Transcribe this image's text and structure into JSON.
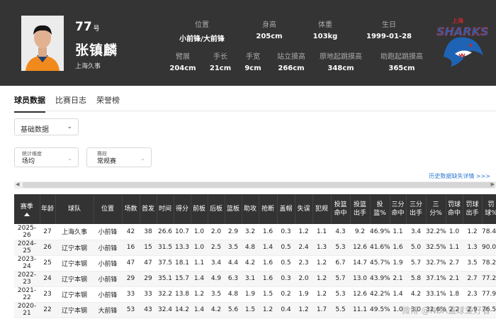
{
  "player": {
    "number": "77",
    "number_suffix": "号",
    "name": "张镇麟",
    "team": "上海久事"
  },
  "attrs_top": [
    {
      "label": "位置",
      "value": "小前锋/大前锋"
    },
    {
      "label": "身高",
      "value": "205cm"
    },
    {
      "label": "体重",
      "value": "103kg"
    },
    {
      "label": "生日",
      "value": "1999-01-28"
    }
  ],
  "attrs_bottom": [
    {
      "label": "臂展",
      "value": "204cm"
    },
    {
      "label": "手长",
      "value": "21cm"
    },
    {
      "label": "手宽",
      "value": "9cm"
    },
    {
      "label": "站立摸高",
      "value": "266cm"
    },
    {
      "label": "原地起跳摸高",
      "value": "348cm"
    },
    {
      "label": "助跑起跳摸高",
      "value": "365cm"
    }
  ],
  "logo": {
    "text": "SHARKS",
    "top_text": "上海",
    "primary": "#1f63b5",
    "accent": "#c7282d"
  },
  "tabs": [
    "球员数据",
    "比赛日志",
    "荣誉榜"
  ],
  "filters": {
    "data_type": "基础数据",
    "dimension_label": "统计维度",
    "dimension_value": "场均",
    "stage_label": "赛段",
    "stage_value": "常规赛"
  },
  "history_link": "历史数据缺失详情 >>>",
  "table": {
    "headers": [
      "赛季",
      "年龄",
      "球队",
      "位置",
      "场数",
      "首发",
      "时间",
      "得分",
      "前板",
      "后板",
      "篮板",
      "助攻",
      "抢断",
      "盖帽",
      "失误",
      "犯规",
      "投篮命中",
      "投篮出手",
      "投篮%",
      "三分命中",
      "三分出手",
      "三分%",
      "罚球命中",
      "罚球出手",
      "罚球%"
    ],
    "rows": [
      [
        "2025-26",
        "27",
        "上海久事",
        "小前锋",
        "42",
        "38",
        "26.6",
        "10.7",
        "1.0",
        "2.0",
        "2.9",
        "3.2",
        "1.6",
        "0.3",
        "1.2",
        "1.1",
        "4.3",
        "9.2",
        "46.9%",
        "1.1",
        "3.4",
        "32.2%",
        "1.0",
        "1.2",
        "78.4%"
      ],
      [
        "2024-25",
        "26",
        "辽宁本钢",
        "小前锋",
        "16",
        "15",
        "31.5",
        "13.3",
        "1.0",
        "2.5",
        "3.5",
        "4.8",
        "1.4",
        "0.5",
        "2.4",
        "1.3",
        "5.3",
        "12.6",
        "41.6%",
        "1.6",
        "5.0",
        "32.5%",
        "1.1",
        "1.3",
        "90.0%"
      ],
      [
        "2023-24",
        "25",
        "辽宁本钢",
        "小前锋",
        "47",
        "47",
        "37.5",
        "18.1",
        "1.1",
        "3.4",
        "4.4",
        "4.2",
        "1.6",
        "0.5",
        "2.3",
        "1.2",
        "6.7",
        "14.7",
        "45.7%",
        "1.9",
        "5.7",
        "32.7%",
        "2.7",
        "3.5",
        "78.2%"
      ],
      [
        "2022-23",
        "24",
        "辽宁本钢",
        "小前锋",
        "29",
        "29",
        "35.1",
        "15.7",
        "1.4",
        "4.9",
        "6.3",
        "3.1",
        "1.6",
        "0.3",
        "2.0",
        "1.2",
        "5.7",
        "13.0",
        "43.9%",
        "2.1",
        "5.8",
        "37.1%",
        "2.1",
        "2.7",
        "77.2%"
      ],
      [
        "2021-22",
        "23",
        "辽宁本钢",
        "小前锋",
        "33",
        "33",
        "32.2",
        "13.8",
        "1.2",
        "3.5",
        "4.8",
        "1.9",
        "1.5",
        "0.2",
        "1.9",
        "1.2",
        "5.3",
        "12.6",
        "42.2%",
        "1.4",
        "4.2",
        "33.1%",
        "1.8",
        "2.3",
        "77.9%"
      ],
      [
        "2020-21",
        "22",
        "辽宁本钢",
        "大前锋",
        "53",
        "43",
        "32.4",
        "14.2",
        "1.4",
        "4.2",
        "5.6",
        "1.5",
        "1.2",
        "0.4",
        "1.2",
        "1.7",
        "5.5",
        "11.1",
        "49.5%",
        "1.0",
        "3.0",
        "32.6%",
        "2.2",
        "2.9",
        "76.5%"
      ]
    ]
  },
  "watermark": "微博 @NBA篮球爱好者"
}
